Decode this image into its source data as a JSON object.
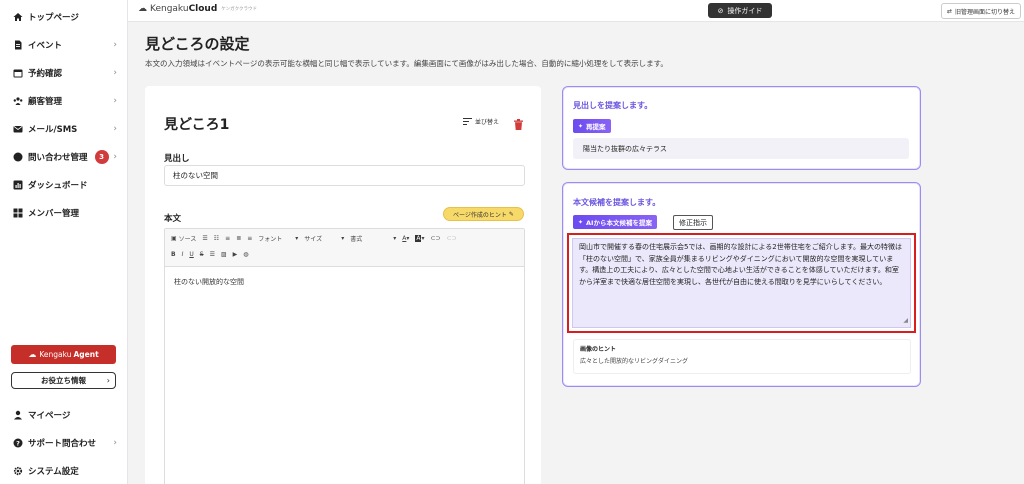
{
  "sidebar": {
    "items": [
      {
        "label": "トップページ",
        "icon": "home-icon",
        "chevron": false
      },
      {
        "label": "イベント",
        "icon": "document-icon",
        "chevron": true
      },
      {
        "label": "予約確認",
        "icon": "calendar-icon",
        "chevron": true
      },
      {
        "label": "顧客管理",
        "icon": "people-icon",
        "chevron": true
      },
      {
        "label": "メール/SMS",
        "icon": "mail-icon",
        "chevron": true
      },
      {
        "label": "問い合わせ管理",
        "icon": "chat-icon",
        "chevron": true,
        "badge": "3"
      },
      {
        "label": "ダッシュボード",
        "icon": "chart-icon",
        "chevron": false
      },
      {
        "label": "メンバー管理",
        "icon": "grid-icon",
        "chevron": false
      }
    ],
    "agent_button": {
      "prefix": "Kengaku",
      "bold": "Agent"
    },
    "useful_button": "お役立ち情報",
    "bottom_items": [
      {
        "label": "マイページ",
        "icon": "user-icon",
        "chevron": false
      },
      {
        "label": "サポート問合わせ",
        "icon": "help-icon",
        "chevron": true
      },
      {
        "label": "システム設定",
        "icon": "gear-icon",
        "chevron": false
      }
    ]
  },
  "topbar": {
    "logo_prefix": "Kengaku",
    "logo_bold": "Cloud",
    "logo_sub": "ケンガククラウド",
    "guide_button": "操作ガイド",
    "switch_button": "旧管理画面に切り替え"
  },
  "page": {
    "title": "見どころの設定",
    "description": "本文の入力領域はイベントページの表示可能な横幅と同じ幅で表示しています。編集画面にて画像がはみ出した場合、自動的に縮小処理をして表示します。"
  },
  "section": {
    "title": "見どころ1",
    "sort_label": "並び替え",
    "heading_label": "見出し",
    "heading_value": "柱のない空間",
    "body_label": "本文",
    "hint_button": "ページ作成のヒント",
    "toolbar": {
      "source": "ソース",
      "font": "フォント",
      "size": "サイズ",
      "format": "書式"
    },
    "body_text": "柱のない開放的な空間"
  },
  "suggest_heading": {
    "title": "見出しを提案します。",
    "button": "再提案",
    "value": "陽当たり抜群の広々テラス"
  },
  "suggest_body": {
    "title": "本文候補を提案します。",
    "ai_button": "AIから本文候補を提案",
    "fix_button": "修正指示",
    "text": "岡山市で開催する春の住宅展示会5では、画期的な設計による2世帯住宅をご紹介します。最大の特徴は「柱のない空間」で、家族全員が集まるリビングやダイニングにおいて開放的な空間を実現しています。構造上の工夫により、広々とした空間で心地よい生活ができることを体感していただけます。和室から洋室まで快適な居住空間を実現し、各世代が自由に使える間取りを見学にいらしてください。",
    "image_hint_label": "画像のヒント",
    "image_hint_value": "広々とした開放的なリビングダイニング"
  },
  "colors": {
    "accent": "#6a56e0",
    "agent": "#c62f29",
    "highlight": "#d71f1f",
    "hint": "#f7d96a"
  }
}
